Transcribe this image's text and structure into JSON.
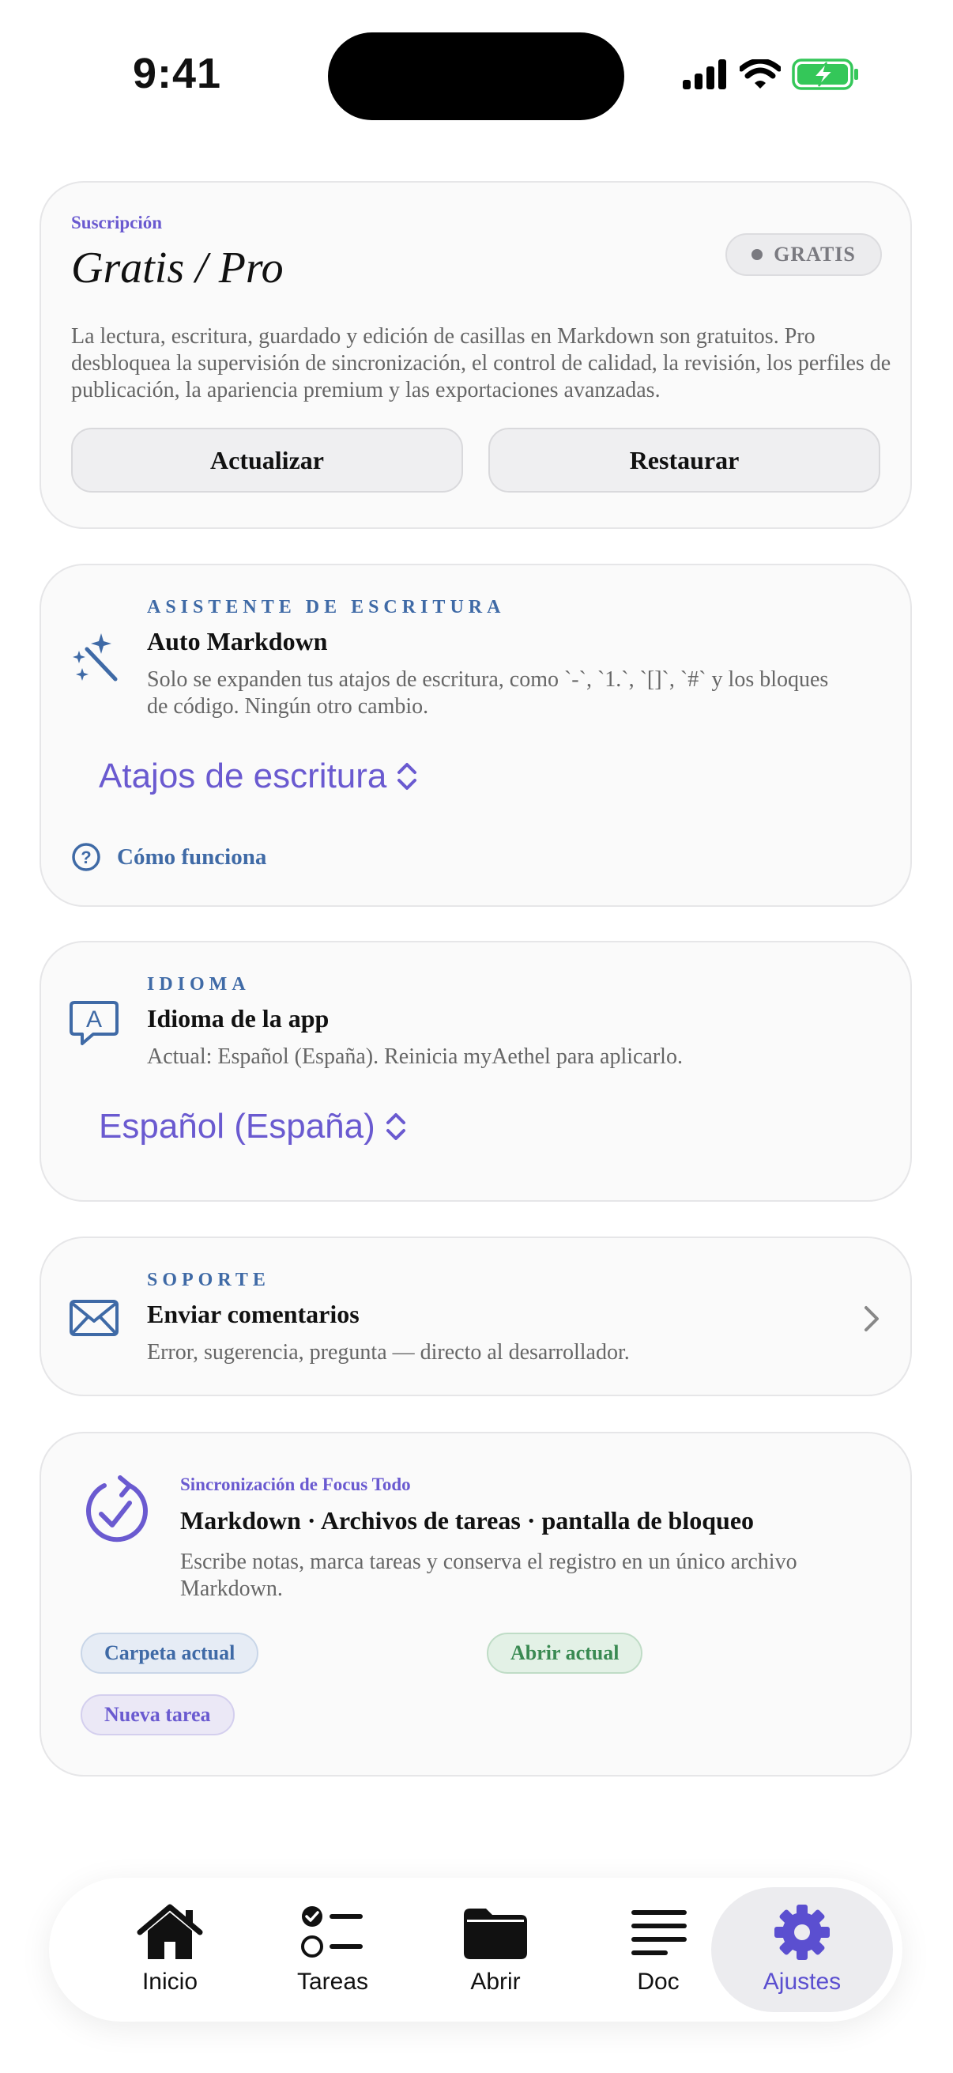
{
  "status_bar": {
    "time": "9:41"
  },
  "subscription": {
    "eyebrow": "Suscripción",
    "title": "Gratis / Pro",
    "badge": "GRATIS",
    "description": "La lectura, escritura, guardado y edición de casillas en Markdown son gratuitos. Pro desbloquea la supervisión de sincronización, el control de calidad, la revisión, los perfiles de publicación, la apariencia premium y las exportaciones avanzadas.",
    "upgrade_label": "Actualizar",
    "restore_label": "Restaurar"
  },
  "writing_assistant": {
    "eyebrow": "ASISTENTE DE ESCRITURA",
    "title": "Auto Markdown",
    "description": "Solo se expanden tus atajos de escritura, como `-`, `1.`, `[]`, `#` y los bloques de código. Ningún otro cambio.",
    "picker_value": "Atajos de escritura",
    "help_label": "Cómo funciona"
  },
  "language": {
    "eyebrow": "IDIOMA",
    "title": "Idioma de la app",
    "description": "Actual: Español (España). Reinicia myAethel para aplicarlo.",
    "picker_value": "Español (España)"
  },
  "support": {
    "eyebrow": "SOPORTE",
    "title": "Enviar comentarios",
    "description": "Error, sugerencia, pregunta — directo al desarrollador."
  },
  "focus_sync": {
    "eyebrow": "Sincronización de Focus Todo",
    "title": "Markdown · Archivos de tareas · pantalla de bloqueo",
    "description": "Escribe notas, marca tareas y conserva el registro en un único archivo Markdown.",
    "chips": {
      "current_folder": "Carpeta actual",
      "open_current": "Abrir actual",
      "new_task": "Nueva tarea"
    }
  },
  "tabbar": {
    "items": [
      {
        "label": "Inicio",
        "icon": "house-icon"
      },
      {
        "label": "Tareas",
        "icon": "checklist-icon"
      },
      {
        "label": "Abrir",
        "icon": "folder-icon"
      },
      {
        "label": "Doc",
        "icon": "text-lines-icon"
      },
      {
        "label": "Ajustes",
        "icon": "gear-icon"
      }
    ],
    "active": "Ajustes"
  },
  "colors": {
    "accent": "#6a5ad0",
    "eyebrow_blue": "#3f6aa6",
    "battery_green": "#34c759"
  }
}
